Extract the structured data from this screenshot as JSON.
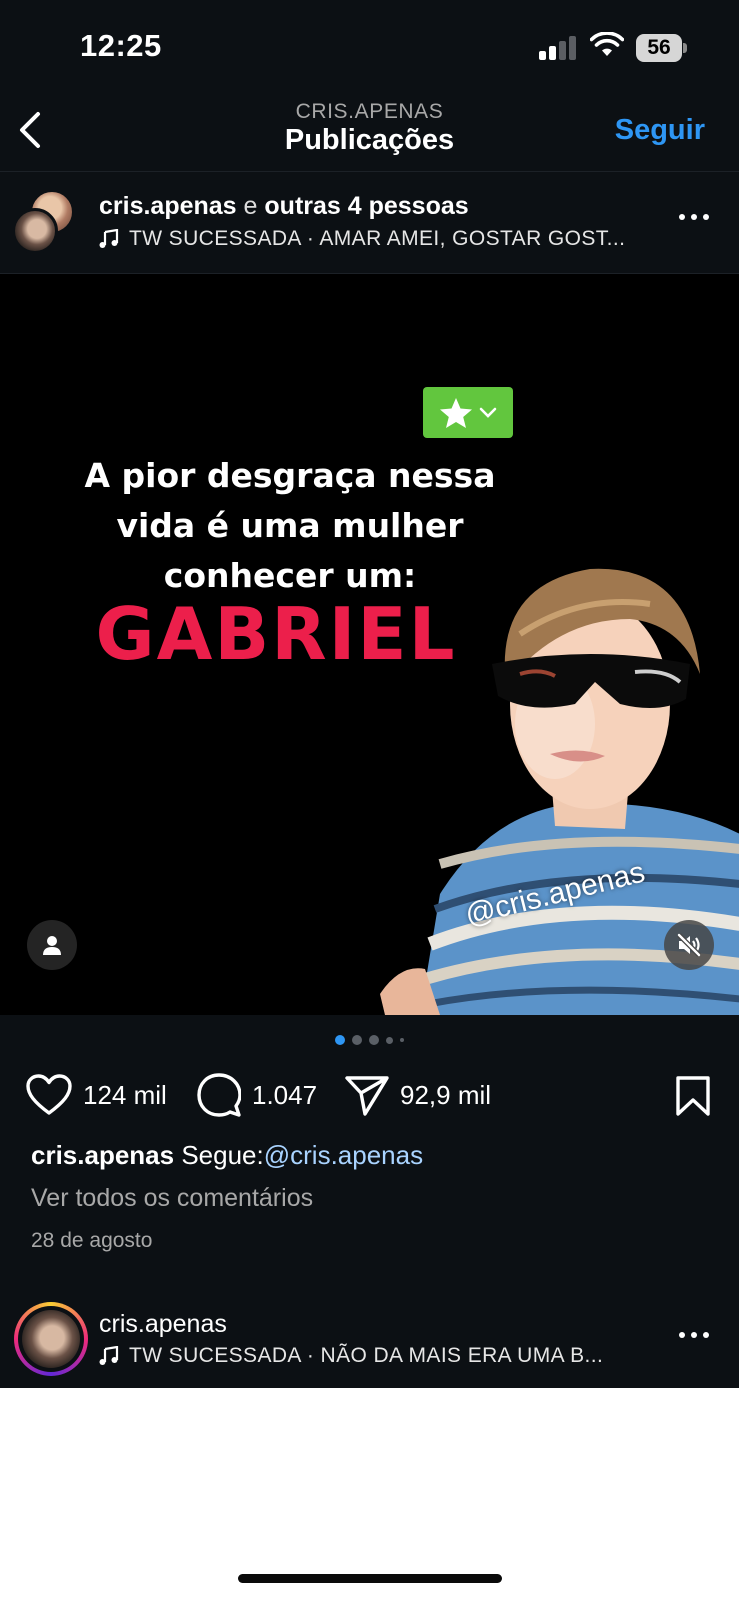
{
  "status_bar": {
    "time": "12:25",
    "battery": "56"
  },
  "header": {
    "subtitle": "CRIS.APENAS",
    "title": "Publicações",
    "follow_label": "Seguir"
  },
  "post": {
    "username": "cris.apenas",
    "coauthors_connector": "e",
    "coauthors": "outras 4 pessoas",
    "music": "TW SUCESSADA · AMAR AMEI, GOSTAR GOST...",
    "media": {
      "text_lines": [
        "A pior desgraça nessa",
        "vida é uma mulher",
        "conhecer um:"
      ],
      "name": "GABRIEL",
      "watermark": "@cris.apenas"
    },
    "carousel": {
      "count": 5,
      "active": 0
    },
    "likes": "124 mil",
    "comments": "1.047",
    "shares": "92,9 mil",
    "caption": {
      "username": "cris.apenas",
      "text": "Segue:",
      "mention": "@cris.apenas"
    },
    "view_comments": "Ver todos os comentários",
    "date": "28 de agosto"
  },
  "next_post": {
    "username": "cris.apenas",
    "music": "TW SUCESSADA · NÃO DA MAIS ERA UMA B..."
  },
  "colors": {
    "background": "#0c1014",
    "accent": "#2e96f4",
    "meme_name": "#ec1f4b",
    "badge": "#62c63e"
  }
}
